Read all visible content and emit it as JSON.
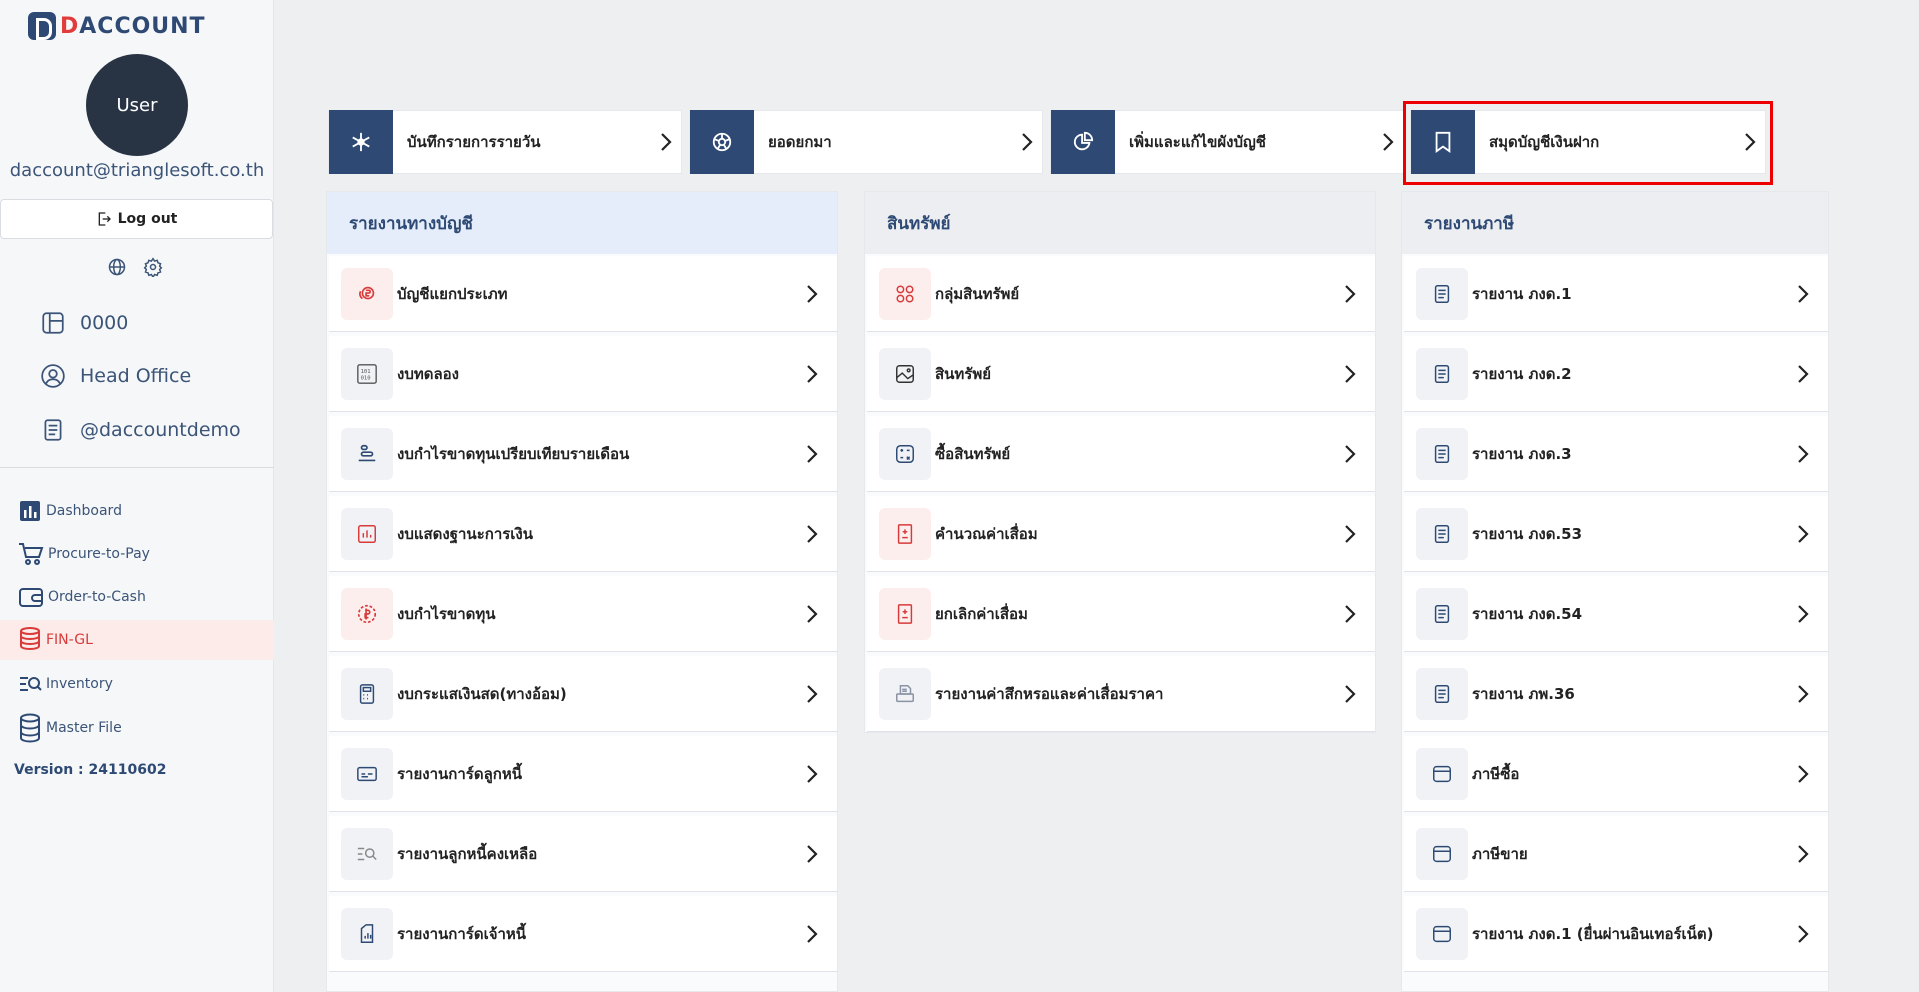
{
  "app": {
    "logo_prefix": "D",
    "logo_text": "ACCOUNT"
  },
  "user": {
    "avatar_text": "User",
    "email": "daccount@trianglesoft.co.th",
    "logout_label": "Log out"
  },
  "info": {
    "company_code": "0000",
    "branch": "Head Office",
    "account": "@daccountdemo"
  },
  "nav": {
    "items": [
      {
        "label": "Dashboard",
        "icon": "bar-chart-icon"
      },
      {
        "label": "Procure-to-Pay",
        "icon": "cart-icon"
      },
      {
        "label": "Order-to-Cash",
        "icon": "wallet-icon"
      },
      {
        "label": "FIN-GL",
        "icon": "coins-icon"
      },
      {
        "label": "Inventory",
        "icon": "list-search-icon"
      },
      {
        "label": "Master File",
        "icon": "database-icon"
      }
    ],
    "active": "FIN-GL"
  },
  "version": "Version : 24110602",
  "quick": [
    {
      "label": "บันทึกรายการรายวัน",
      "icon": "snowflake-icon"
    },
    {
      "label": "ยอดยกมา",
      "icon": "aperture-icon"
    },
    {
      "label": "เพิ่มและแก้ไขผังบัญชี",
      "icon": "pie-chart-icon"
    },
    {
      "label": "สมุดบัญชีเงินฝาก",
      "icon": "bookmark-icon"
    }
  ],
  "panels": {
    "accounting": {
      "title": "รายงานทางบัญชี",
      "rows": [
        "บัญชีแยกประเภท",
        "งบทดลอง",
        "งบกำไรขาดทุนเปรียบเทียบรายเดือน",
        "งบแสดงฐานะการเงิน",
        "งบกำไรขาดทุน",
        "งบกระแสเงินสด(ทางอ้อม)",
        "รายงานการ์ดลูกหนี้",
        "รายงานลูกหนี้คงเหลือ",
        "รายงานการ์ดเจ้าหนี้"
      ]
    },
    "assets": {
      "title": "สินทรัพย์",
      "rows": [
        "กลุ่มสินทรัพย์",
        "สินทรัพย์",
        "ซื้อสินทรัพย์",
        "คำนวณค่าเสื่อม",
        "ยกเลิกค่าเสื่อม",
        "รายงานค่าสึกหรอและค่าเสื่อมราคา"
      ]
    },
    "tax": {
      "title": "รายงานภาษี",
      "rows": [
        "รายงาน ภงด.1",
        "รายงาน ภงด.2",
        "รายงาน ภงด.3",
        "รายงาน ภงด.53",
        "รายงาน ภงด.54",
        "รายงาน ภพ.36",
        "ภาษีซื้อ",
        "ภาษีขาย",
        "รายงาน ภงด.1 (ยื่นผ่านอินเทอร์เน็ต)"
      ]
    }
  },
  "colors": {
    "brand": "#2e4a74",
    "accent_red": "#e23b3b",
    "highlight": "#ee0000"
  }
}
